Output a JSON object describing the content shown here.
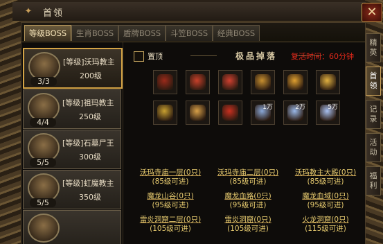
{
  "window": {
    "title": "首领",
    "close_label": "✕"
  },
  "tabs": [
    "等级BOSS",
    "生肖BOSS",
    "盾牌BOSS",
    "斗笠BOSS",
    "经典BOSS"
  ],
  "side_tabs": [
    "精英",
    "首领",
    "记录",
    "活动",
    "福利"
  ],
  "bosses": [
    {
      "name": "[等级]沃玛教主",
      "level": "200级",
      "count": "3/3"
    },
    {
      "name": "[等级]祖玛教主",
      "level": "250级",
      "count": "4/4"
    },
    {
      "name": "[等级]石墓尸王",
      "level": "300级",
      "count": "5/5"
    },
    {
      "name": "[等级]虹魔教主",
      "level": "350级",
      "count": "5/5"
    }
  ],
  "pin_label": "置顶",
  "drops_title": "极品掉落",
  "revive_text": "复活时间：60分钟",
  "items": [
    {
      "icon": "gauntlet-icon",
      "color": "#9a2a1a",
      "qty": ""
    },
    {
      "icon": "armor-icon",
      "color": "#c8402a",
      "qty": ""
    },
    {
      "icon": "armor-icon",
      "color": "#d04030",
      "qty": ""
    },
    {
      "icon": "helmet-icon",
      "color": "#c89030",
      "qty": ""
    },
    {
      "icon": "necklace-icon",
      "color": "#e0a030",
      "qty": ""
    },
    {
      "icon": "bracelet-icon",
      "color": "#e0b040",
      "qty": ""
    },
    {
      "icon": "ring-icon",
      "color": "#c8a030",
      "qty": ""
    },
    {
      "icon": "crown-icon",
      "color": "#d8a048",
      "qty": ""
    },
    {
      "icon": "boots-icon",
      "color": "#c83020",
      "qty": ""
    },
    {
      "icon": "scroll-icon",
      "color": "#8aa8d8",
      "qty": "1万"
    },
    {
      "icon": "scroll-icon",
      "color": "#9ab8e8",
      "qty": "2万"
    },
    {
      "icon": "scroll-icon",
      "color": "#a8c0f0",
      "qty": "5万"
    }
  ],
  "locations": [
    {
      "name": "沃玛寺庙一层(0只)",
      "req": "(85级可进)"
    },
    {
      "name": "沃玛寺庙二层(0只)",
      "req": "(85级可进)"
    },
    {
      "name": "沃玛教主大殿(0只)",
      "req": "(85级可进)"
    },
    {
      "name": "魔龙山谷(0只)",
      "req": "(95级可进)"
    },
    {
      "name": "魔龙血路(0只)",
      "req": "(95级可进)"
    },
    {
      "name": "魔龙血域(0只)",
      "req": "(95级可进)"
    },
    {
      "name": "雷炎洞窟二层(0只)",
      "req": "(105级可进)"
    },
    {
      "name": "雷炎洞窟(0只)",
      "req": "(105级可进)"
    },
    {
      "name": "火龙洞窟(0只)",
      "req": "(115级可进)"
    }
  ]
}
